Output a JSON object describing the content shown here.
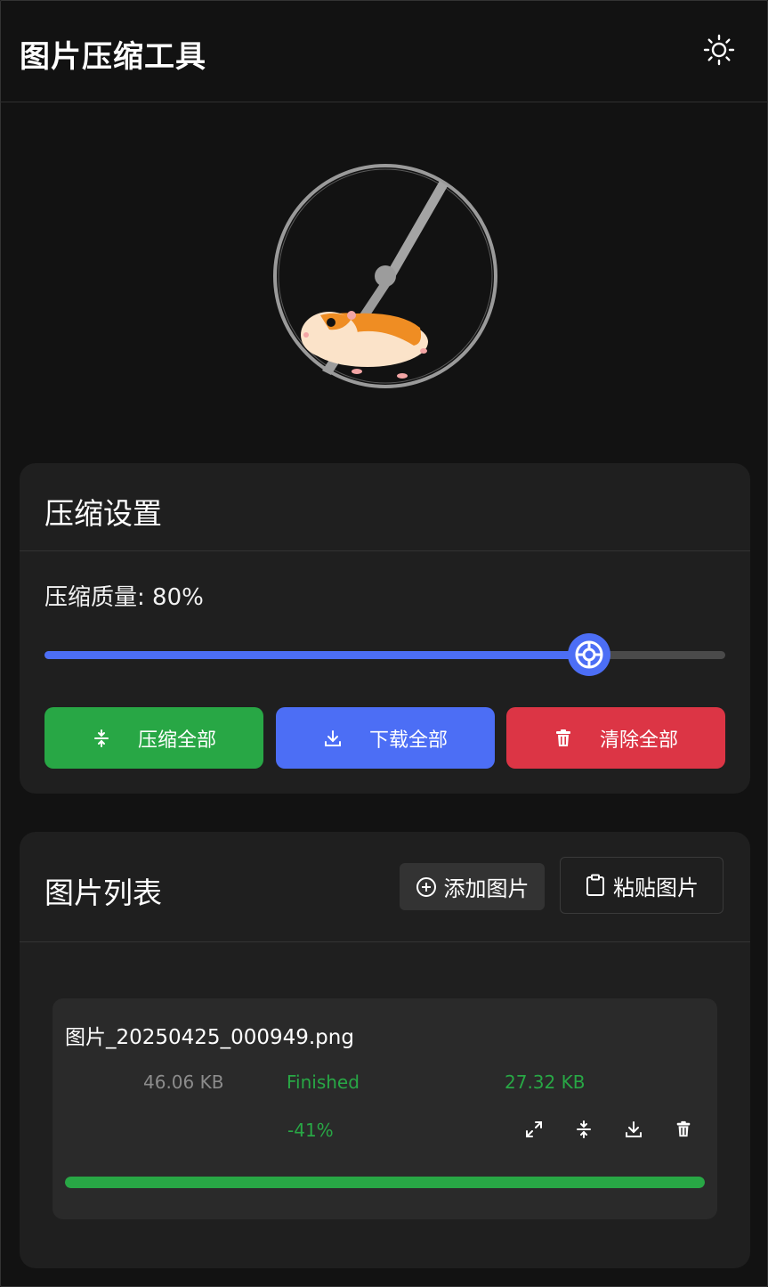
{
  "header": {
    "title": "图片压缩工具",
    "theme_icon": "sun-icon"
  },
  "settings": {
    "title": "压缩设置",
    "quality_label": "压缩质量: 80%",
    "quality_value": 80,
    "buttons": {
      "compress_all": "压缩全部",
      "download_all": "下载全部",
      "clear_all": "清除全部"
    }
  },
  "image_list": {
    "title": "图片列表",
    "add_label": "添加图片",
    "paste_label": "粘贴图片",
    "items": [
      {
        "name": "图片_20250425_000949.png",
        "original_size": "46.06 KB",
        "status": "Finished",
        "compressed_size": "27.32 KB",
        "reduction": "-41%",
        "progress": 100
      }
    ]
  },
  "colors": {
    "accent": "#4c6ef5",
    "success": "#28a745",
    "danger": "#dc3545",
    "background": "#121212",
    "card": "#1f1f1f"
  }
}
